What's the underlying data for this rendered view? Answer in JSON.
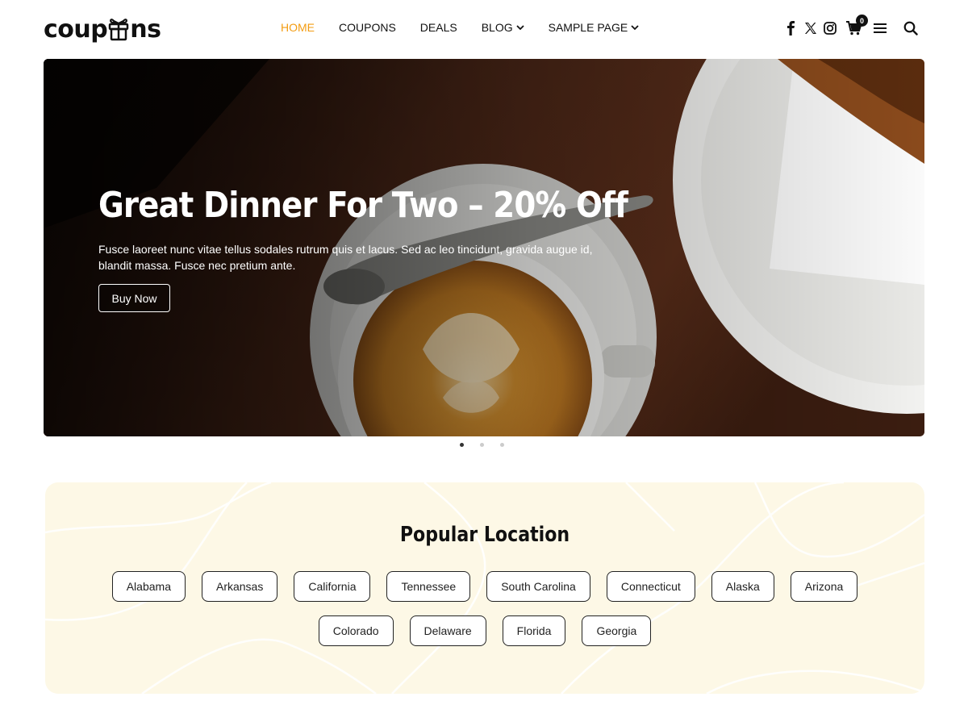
{
  "brand": {
    "logo_text_left": "coup",
    "logo_text_right": "ns",
    "accent_color": "#f39c12"
  },
  "nav": {
    "items": [
      {
        "label": "HOME",
        "active": true,
        "has_dropdown": false
      },
      {
        "label": "COUPONS",
        "active": false,
        "has_dropdown": false
      },
      {
        "label": "DEALS",
        "active": false,
        "has_dropdown": false
      },
      {
        "label": "BLOG",
        "active": false,
        "has_dropdown": true
      },
      {
        "label": "SAMPLE PAGE",
        "active": false,
        "has_dropdown": true
      }
    ]
  },
  "header_icons": {
    "social": [
      "facebook-icon",
      "x-icon",
      "instagram-icon"
    ],
    "cart_count": "0",
    "menu": "menu-icon",
    "search": "search-icon"
  },
  "hero": {
    "title": "Great Dinner For Two – 20% Off",
    "text": "Fusce laoreet nunc vitae tellus sodales rutrum quis et lacus. Sed ac leo tincidunt, gravida augue id, blandit massa. Fusce nec pretium ante.",
    "button_label": "Buy Now",
    "slides": 3,
    "active_slide": 1
  },
  "locations": {
    "title": "Popular Location",
    "row1": [
      "Alabama",
      "Arkansas",
      "California",
      "Tennessee",
      "South Carolina",
      "Connecticut",
      "Alaska",
      "Arizona"
    ],
    "row2": [
      "Colorado",
      "Delaware",
      "Florida",
      "Georgia"
    ]
  }
}
